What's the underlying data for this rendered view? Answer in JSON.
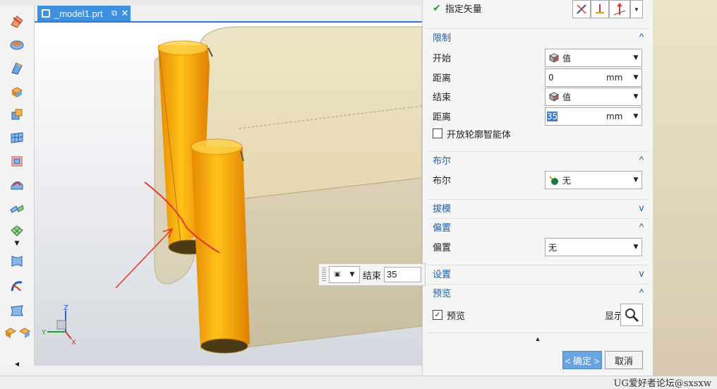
{
  "tab": {
    "title": "_model1.prt"
  },
  "mini_toolbar": {
    "end_label": "结束",
    "end_value": "35"
  },
  "dialog": {
    "vector_label": "指定矢量",
    "sections": {
      "limits": "限制",
      "boolean": "布尔",
      "draft": "拔模",
      "offset": "偏置",
      "settings": "设置",
      "preview": "预览"
    },
    "limits": {
      "start_label": "开始",
      "start_value": "值",
      "distance1_label": "距离",
      "distance1_value": "0",
      "distance1_unit": "mm",
      "end_label": "结束",
      "end_value": "值",
      "distance2_label": "距离",
      "distance2_value": "35",
      "distance2_unit": "mm",
      "open_profile_label": "开放轮廓智能体"
    },
    "boolean": {
      "label": "布尔",
      "value": "无"
    },
    "offset": {
      "label": "偏置",
      "value": "无"
    },
    "preview": {
      "checkbox_label": "预览",
      "show_result_label": "显示结果"
    },
    "ok_label": "< 确定 >",
    "cancel_label": "取消"
  },
  "axes": {
    "x": "X",
    "y": "Y",
    "z": "Z"
  },
  "watermark": "UG爱好者论坛@sxsxw",
  "colors": {
    "accent": "#2c7bd6",
    "section_title": "#1d5fa8",
    "cylinder": "#f5a400",
    "body": "#d9cfb1",
    "annotation": "#e8332a"
  }
}
